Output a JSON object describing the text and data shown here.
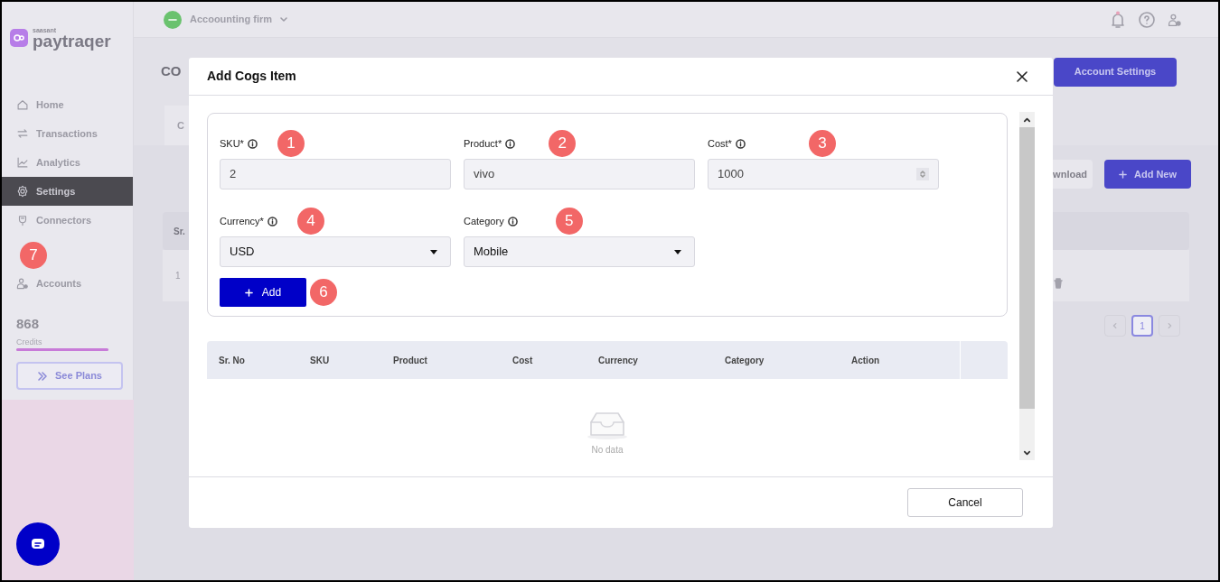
{
  "app": {
    "brand_small": "saasant",
    "brand": "paytraqer",
    "company": "Accoounting firm"
  },
  "sidebar": {
    "items": [
      {
        "label": "Home",
        "selected": false
      },
      {
        "label": "Transactions",
        "selected": false
      },
      {
        "label": "Analytics",
        "selected": false
      },
      {
        "label": "Settings",
        "selected": true
      },
      {
        "label": "Connectors",
        "selected": false
      },
      {
        "label": "Accounts",
        "selected": false,
        "annotation": "7"
      }
    ],
    "credits": {
      "value": "868",
      "label": "Credits",
      "level": 1
    },
    "see_plans": "See Plans"
  },
  "page": {
    "title": "CO",
    "tab": "C",
    "account_settings": "Account Settings",
    "download": "wnload",
    "add_new": "Add New",
    "table": {
      "header": "Sr.",
      "row": "1"
    },
    "pagination": "1"
  },
  "modal": {
    "title": "Add Cogs Item",
    "fields": [
      {
        "label": "SKU*",
        "value": "2",
        "kind": "text",
        "annotation": "1"
      },
      {
        "label": "Product*",
        "value": "vivo",
        "kind": "text",
        "annotation": "2"
      },
      {
        "label": "Cost*",
        "value": "1000",
        "kind": "number",
        "annotation": "3"
      },
      {
        "label": "Currency*",
        "value": "USD",
        "kind": "select",
        "annotation": "4"
      },
      {
        "label": "Category",
        "value": "Mobile",
        "kind": "select",
        "annotation": "5"
      }
    ],
    "add_button": {
      "label": "Add",
      "annotation": "6"
    },
    "table": {
      "columns": [
        "Sr. No",
        "SKU",
        "Product",
        "Cost",
        "Currency",
        "Category",
        "Action"
      ],
      "empty_text": "No data"
    },
    "cancel": "Cancel"
  }
}
